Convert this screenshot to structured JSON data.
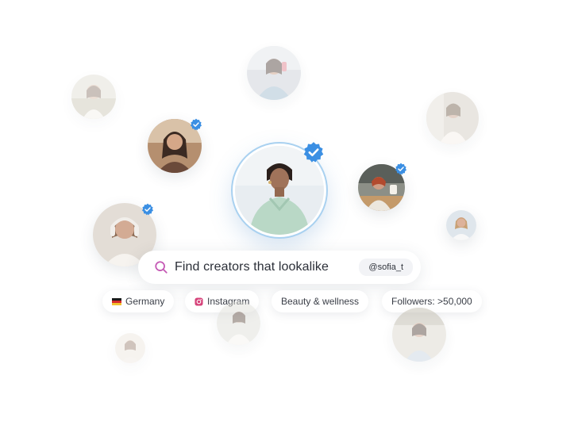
{
  "search": {
    "query_text": "Find creators that lookalike",
    "handle": "@sofia_t"
  },
  "filters": [
    {
      "label": "Germany",
      "icon": "germany-flag-icon"
    },
    {
      "label": "Instagram",
      "icon": "instagram-icon"
    },
    {
      "label": "Beauty & wellness",
      "icon": ""
    },
    {
      "label": "Followers: >50,000",
      "icon": ""
    }
  ],
  "colors": {
    "verified": "#3b8fe3",
    "search_icon": "#c55ab5",
    "main_ring": "#a9d1f0",
    "chip_bg": "#ffffff"
  }
}
